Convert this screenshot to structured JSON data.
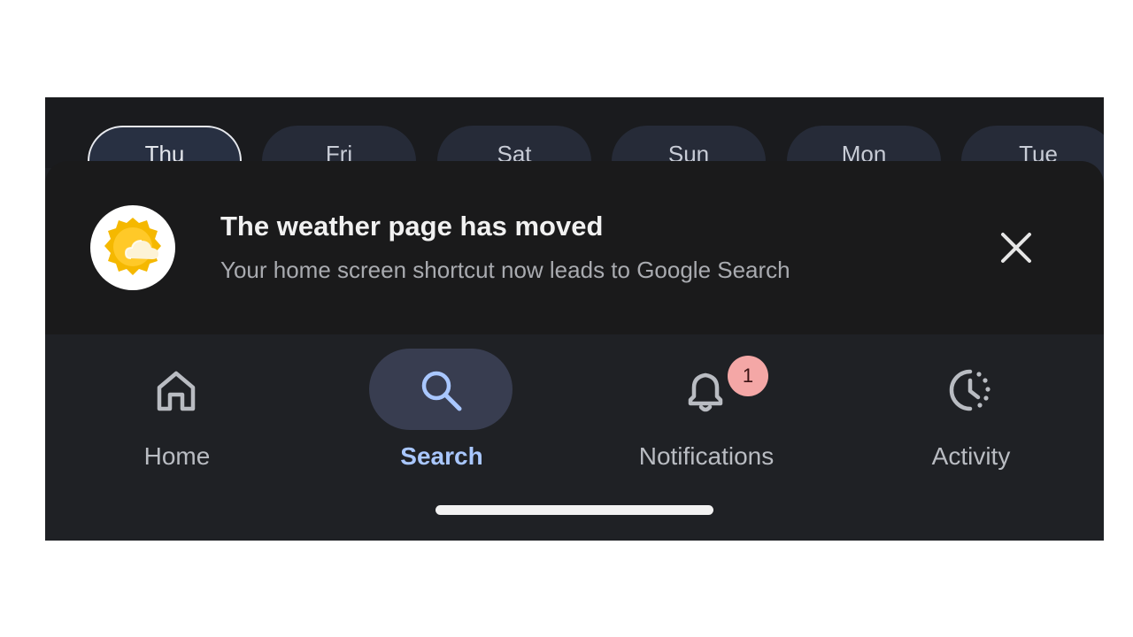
{
  "days": [
    "Thu",
    "Fri",
    "Sat",
    "Sun",
    "Mon",
    "Tue"
  ],
  "selected_day": "Thu",
  "banner": {
    "title": "The weather page has moved",
    "subtitle": "Your home screen shortcut now leads to Google Search",
    "logo_icon": "weather-sun-cloud-icon",
    "close_icon": "close-icon"
  },
  "nav": {
    "home": {
      "label": "Home",
      "icon": "home-icon"
    },
    "search": {
      "label": "Search",
      "icon": "search-icon"
    },
    "notifications": {
      "label": "Notifications",
      "icon": "bell-icon",
      "badge": "1"
    },
    "activity": {
      "label": "Activity",
      "icon": "activity-clock-icon"
    }
  },
  "colors": {
    "background": "#1f2125",
    "accent": "#a9c7ff",
    "active_pill": "#383d50",
    "badge": "#f4a7a6",
    "logo_sun": "#f5b800"
  }
}
